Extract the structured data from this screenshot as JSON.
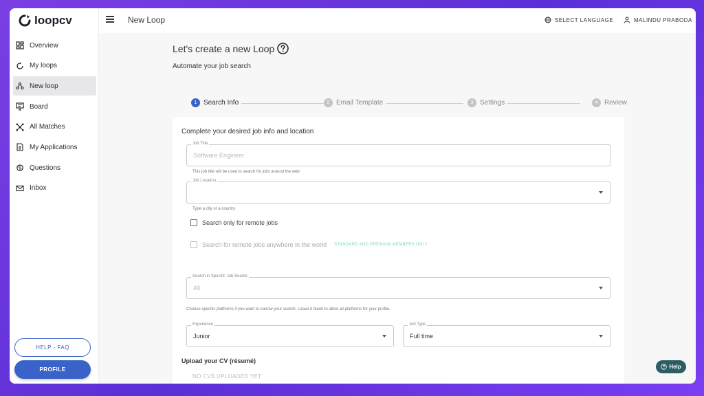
{
  "app": {
    "logo_text": "loopcv"
  },
  "sidebar": {
    "items": [
      {
        "label": "Overview",
        "icon": "dashboard-icon"
      },
      {
        "label": "My loops",
        "icon": "loop-icon"
      },
      {
        "label": "New loop",
        "icon": "nodes-icon",
        "active": true
      },
      {
        "label": "Board",
        "icon": "board-icon"
      },
      {
        "label": "All Matches",
        "icon": "network-icon"
      },
      {
        "label": "My Applications",
        "icon": "document-icon"
      },
      {
        "label": "Questions",
        "icon": "brain-icon"
      },
      {
        "label": "Inbox",
        "icon": "mail-icon"
      }
    ],
    "help_label": "HELP - FAQ",
    "profile_label": "PROFILE"
  },
  "header": {
    "title": "New Loop",
    "language_label": "SELECT LANGUAGE",
    "user_name": "MALINDU PRABODA"
  },
  "page": {
    "title": "Let's create a new Loop",
    "subtitle": "Automate your job search"
  },
  "stepper": {
    "steps": [
      {
        "number": "1",
        "label": "Search Info",
        "active": true
      },
      {
        "number": "2",
        "label": "Email Template"
      },
      {
        "number": "3",
        "label": "Settings"
      },
      {
        "number": "4",
        "label": "Review"
      }
    ]
  },
  "form": {
    "heading": "Complete your desired job info and location",
    "job_title": {
      "label": "Job Title",
      "placeholder": "Software Engineer",
      "helper": "This job title will be used to search for jobs around the web"
    },
    "job_location": {
      "label": "Job Location",
      "value": "",
      "helper": "Type a city or a country"
    },
    "remote_only": {
      "label": "Search only for remote jobs"
    },
    "remote_anywhere": {
      "label": "Search for remote jobs anywhere in the world",
      "badge": "STANDARD AND PREMIUM MEMBERS ONLY"
    },
    "job_boards": {
      "label": "Search in Specific Job Boards",
      "value": "All",
      "helper": "Choose specific platforms if you want to narrow your search. Leave it blank to allow all platforms for your profile."
    },
    "experience": {
      "label": "Experience",
      "value": "Junior"
    },
    "job_type": {
      "label": "Job Type",
      "value": "Full time"
    },
    "cv_section_title": "Upload your CV (résumé)",
    "no_cv_text": "NO CVS UPLOADED YET"
  },
  "help_widget": {
    "label": "Help"
  },
  "colors": {
    "accent": "#3a63c9",
    "background_gradient": "#6a35e6",
    "help_widget": "#2b5d63",
    "premium_badge": "#7fd3c1"
  }
}
